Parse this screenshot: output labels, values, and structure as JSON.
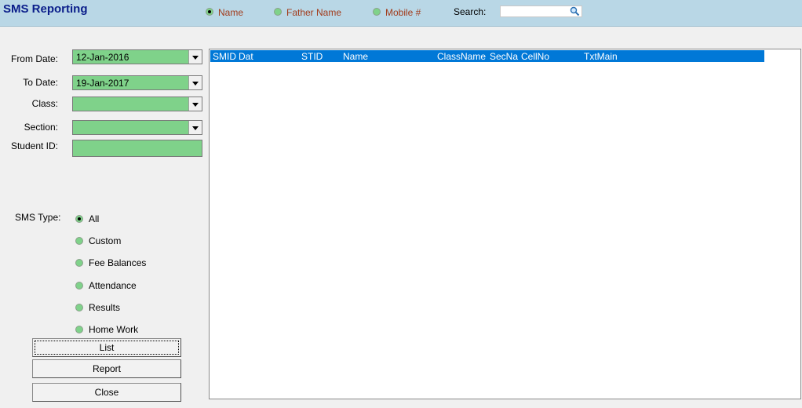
{
  "title": "SMS Reporting",
  "search_mode": {
    "options": [
      {
        "label": "Name",
        "checked": true
      },
      {
        "label": "Father Name",
        "checked": false
      },
      {
        "label": "Mobile #",
        "checked": false
      }
    ],
    "search_label": "Search:",
    "search_value": ""
  },
  "filters": {
    "from_date_label": "From Date:",
    "from_date_value": "12-Jan-2016",
    "to_date_label": "To Date:",
    "to_date_value": "19-Jan-2017",
    "class_label": "Class:",
    "class_value": "",
    "section_label": "Section:",
    "section_value": "",
    "student_id_label": "Student ID:",
    "student_id_value": ""
  },
  "sms_type": {
    "label": "SMS Type:",
    "options": [
      {
        "label": "All",
        "checked": true
      },
      {
        "label": "Custom",
        "checked": false
      },
      {
        "label": "Fee Balances",
        "checked": false
      },
      {
        "label": "Attendance",
        "checked": false
      },
      {
        "label": "Results",
        "checked": false
      },
      {
        "label": "Home Work",
        "checked": false
      }
    ]
  },
  "buttons": {
    "list": "List",
    "report": "Report",
    "close": "Close"
  },
  "grid": {
    "columns": [
      "SMID",
      "Dat",
      "STID",
      "Name",
      "ClassName",
      "SecNa",
      "CellNo",
      "TxtMain"
    ],
    "rows": []
  },
  "colors": {
    "header_bar": "#b9d7e6",
    "title": "#0a1d8a",
    "field_fill": "#7fd28a",
    "grid_header": "#0078d7",
    "radio_label": "#a23b1b"
  }
}
